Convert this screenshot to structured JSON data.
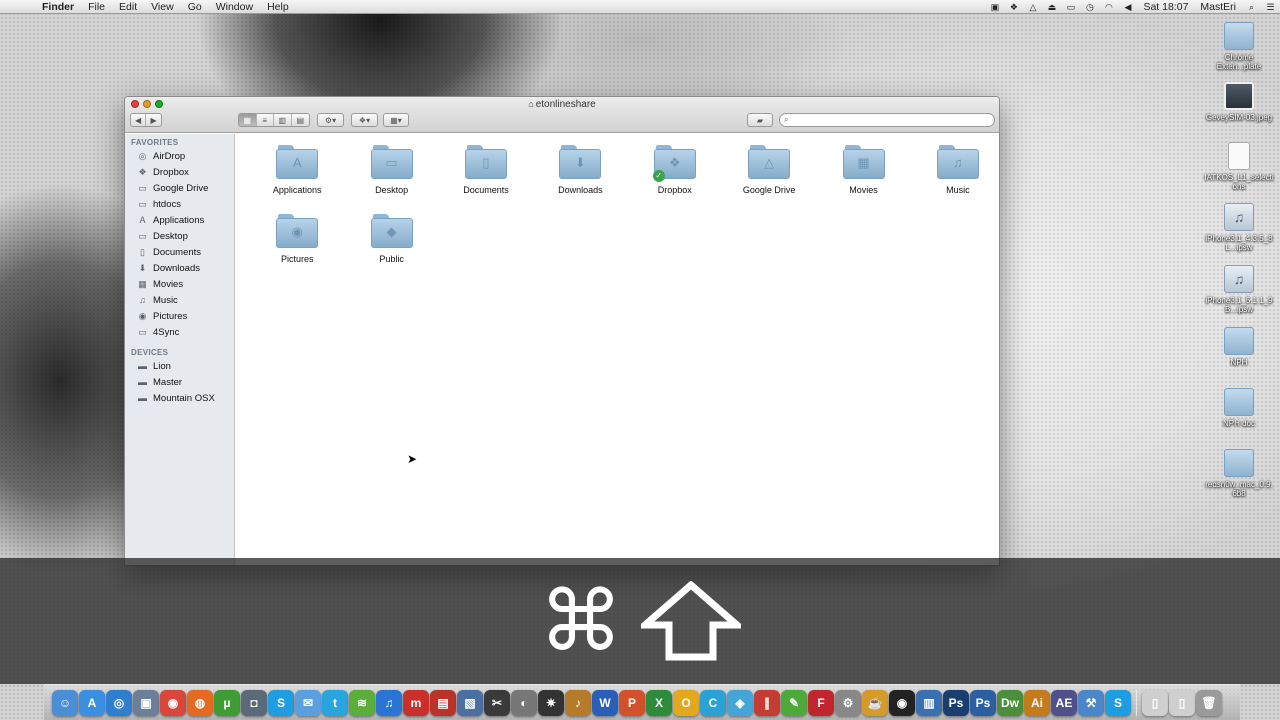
{
  "menubar": {
    "app_name": "Finder",
    "items": [
      "File",
      "Edit",
      "View",
      "Go",
      "Window",
      "Help"
    ],
    "clock": "Sat 18:07",
    "user": "MastEri",
    "status_icons": [
      "camera-icon",
      "dropbox-icon",
      "google-drive-icon",
      "eject-icon",
      "display-icon",
      "time-machine-icon",
      "wifi-icon",
      "volume-icon",
      "spotlight-icon",
      "notification-icon"
    ]
  },
  "window": {
    "title": "etonlineshare",
    "search_placeholder": ""
  },
  "sidebar": {
    "favorites_header": "FAVORITES",
    "favorites": [
      {
        "label": "AirDrop",
        "icon": "airdrop-icon"
      },
      {
        "label": "Dropbox",
        "icon": "dropbox-icon"
      },
      {
        "label": "Google Drive",
        "icon": "folder-icon"
      },
      {
        "label": "htdocs",
        "icon": "folder-icon"
      },
      {
        "label": "Applications",
        "icon": "applications-icon"
      },
      {
        "label": "Desktop",
        "icon": "desktop-icon"
      },
      {
        "label": "Documents",
        "icon": "documents-icon"
      },
      {
        "label": "Downloads",
        "icon": "downloads-icon"
      },
      {
        "label": "Movies",
        "icon": "movies-icon"
      },
      {
        "label": "Music",
        "icon": "music-icon"
      },
      {
        "label": "Pictures",
        "icon": "pictures-icon"
      },
      {
        "label": "4Sync",
        "icon": "folder-icon"
      }
    ],
    "devices_header": "DEVICES",
    "devices": [
      {
        "label": "Lion",
        "icon": "disk-icon"
      },
      {
        "label": "Master",
        "icon": "disk-icon"
      },
      {
        "label": "Mountain OSX",
        "icon": "disk-icon"
      }
    ]
  },
  "files": [
    {
      "label": "Applications",
      "glyph": "A"
    },
    {
      "label": "Desktop",
      "glyph": "▭"
    },
    {
      "label": "Documents",
      "glyph": "▯"
    },
    {
      "label": "Downloads",
      "glyph": "⬇"
    },
    {
      "label": "Dropbox",
      "glyph": "❖",
      "badge": "✓"
    },
    {
      "label": "Google Drive",
      "glyph": "△"
    },
    {
      "label": "Movies",
      "glyph": "▦"
    },
    {
      "label": "Music",
      "glyph": "♫"
    },
    {
      "label": "Pictures",
      "glyph": "◉"
    },
    {
      "label": "Public",
      "glyph": "◆"
    }
  ],
  "desktop_icons": [
    {
      "label": "Chrome Exten...plate",
      "kind": "folder"
    },
    {
      "label": "GeveySIM-03.jpeg",
      "kind": "image"
    },
    {
      "label": "IATKOS_L1_selections",
      "kind": "doc"
    },
    {
      "label": "iPhone3,1_4.3.5_8L...ipsw",
      "kind": "ipsw"
    },
    {
      "label": "iPhone3,1_5.1.1_9B...ipsw",
      "kind": "ipsw"
    },
    {
      "label": "NPH",
      "kind": "folder"
    },
    {
      "label": "NPH doc",
      "kind": "folder"
    },
    {
      "label": "redsn0w_mac_0.9.6b8",
      "kind": "folder"
    }
  ],
  "keys": {
    "command": "⌘",
    "shift": "shift-key-icon"
  },
  "dock": [
    {
      "name": "finder",
      "color": "#4a8fd6",
      "glyph": "☺"
    },
    {
      "name": "app-store",
      "color": "#3b8fe0",
      "glyph": "A"
    },
    {
      "name": "safari",
      "color": "#2f7fd0",
      "glyph": "◎"
    },
    {
      "name": "preview",
      "color": "#6b7f99",
      "glyph": "▣"
    },
    {
      "name": "chrome",
      "color": "#d9463b",
      "glyph": "◉"
    },
    {
      "name": "firefox",
      "color": "#e56a1f",
      "glyph": "◍"
    },
    {
      "name": "utorrent",
      "color": "#3f9c35",
      "glyph": "µ"
    },
    {
      "name": "camera",
      "color": "#5b6a78",
      "glyph": "◘"
    },
    {
      "name": "skype",
      "color": "#1e9de0",
      "glyph": "S"
    },
    {
      "name": "messages",
      "color": "#5aa0e0",
      "glyph": "✉"
    },
    {
      "name": "twitter",
      "color": "#2aa4dd",
      "glyph": "t"
    },
    {
      "name": "spotify",
      "color": "#5cae3c",
      "glyph": "≋"
    },
    {
      "name": "itunes",
      "color": "#2a74d6",
      "glyph": "♫"
    },
    {
      "name": "mendeley",
      "color": "#c9302c",
      "glyph": "m"
    },
    {
      "name": "photo-booth",
      "color": "#b8342b",
      "glyph": "▤"
    },
    {
      "name": "iphoto",
      "color": "#4a6fa0",
      "glyph": "▧"
    },
    {
      "name": "final-cut",
      "color": "#3a3a3a",
      "glyph": "✂"
    },
    {
      "name": "image-capture",
      "color": "#777",
      "glyph": "◐"
    },
    {
      "name": "ninja",
      "color": "#333",
      "glyph": "✷"
    },
    {
      "name": "garageband",
      "color": "#b57a2a",
      "glyph": "♪"
    },
    {
      "name": "word",
      "color": "#2b5fb7",
      "glyph": "W"
    },
    {
      "name": "powerpoint",
      "color": "#d2502a",
      "glyph": "P"
    },
    {
      "name": "excel",
      "color": "#2e8b3a",
      "glyph": "X"
    },
    {
      "name": "outlook",
      "color": "#e2a81f",
      "glyph": "O"
    },
    {
      "name": "ccleaner",
      "color": "#2aa2d8",
      "glyph": "C"
    },
    {
      "name": "network",
      "color": "#44a6d6",
      "glyph": "◈"
    },
    {
      "name": "parallels",
      "color": "#c43c34",
      "glyph": "∥"
    },
    {
      "name": "evernote",
      "color": "#4ea83a",
      "glyph": "✎"
    },
    {
      "name": "filezilla",
      "color": "#c0262d",
      "glyph": "F"
    },
    {
      "name": "system-preferences",
      "color": "#888",
      "glyph": "⚙"
    },
    {
      "name": "coda",
      "color": "#d59a2a",
      "glyph": "☕"
    },
    {
      "name": "dvd-player",
      "color": "#222",
      "glyph": "◉"
    },
    {
      "name": "textwrangler",
      "color": "#3a6fb0",
      "glyph": "▥"
    },
    {
      "name": "photoshop-1",
      "color": "#1a3f6e",
      "glyph": "Ps"
    },
    {
      "name": "photoshop-2",
      "color": "#2b5fa0",
      "glyph": "Ps"
    },
    {
      "name": "dreamweaver",
      "color": "#4b8f3a",
      "glyph": "Dw"
    },
    {
      "name": "illustrator",
      "color": "#c47b1b",
      "glyph": "Ai"
    },
    {
      "name": "after-effects",
      "color": "#50508a",
      "glyph": "AE"
    },
    {
      "name": "xcode",
      "color": "#4a86c8",
      "glyph": "⚒"
    },
    {
      "name": "skype-2",
      "color": "#1e9de0",
      "glyph": "S"
    },
    {
      "name": "documents-stack",
      "color": "#cfcfcf",
      "glyph": "▯"
    },
    {
      "name": "downloads-stack",
      "color": "#cfcfcf",
      "glyph": "▯"
    },
    {
      "name": "trash",
      "color": "#9a9a9a",
      "glyph": "🗑"
    }
  ]
}
